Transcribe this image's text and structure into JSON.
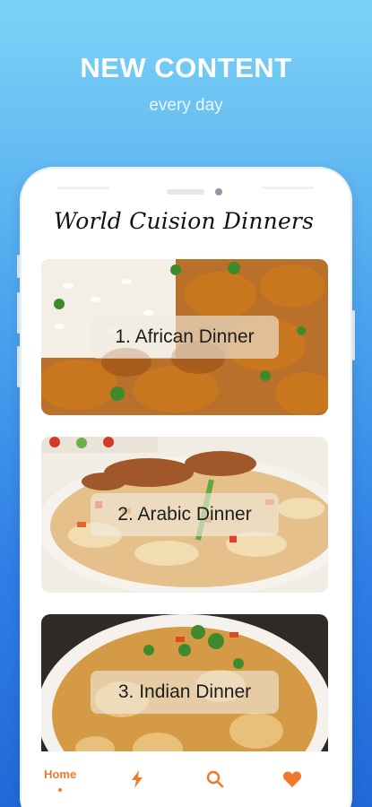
{
  "promo": {
    "title": "NEW CONTENT",
    "subtitle": "every day"
  },
  "app": {
    "title": "World Cuision Dinners"
  },
  "cards": [
    {
      "label": "1. African Dinner"
    },
    {
      "label": "2. Arabic Dinner"
    },
    {
      "label": "3. Indian Dinner"
    }
  ],
  "nav": {
    "home_label": "Home",
    "icons": [
      "lightning-icon",
      "search-icon",
      "heart-icon"
    ],
    "accent": "#f07a2c"
  }
}
